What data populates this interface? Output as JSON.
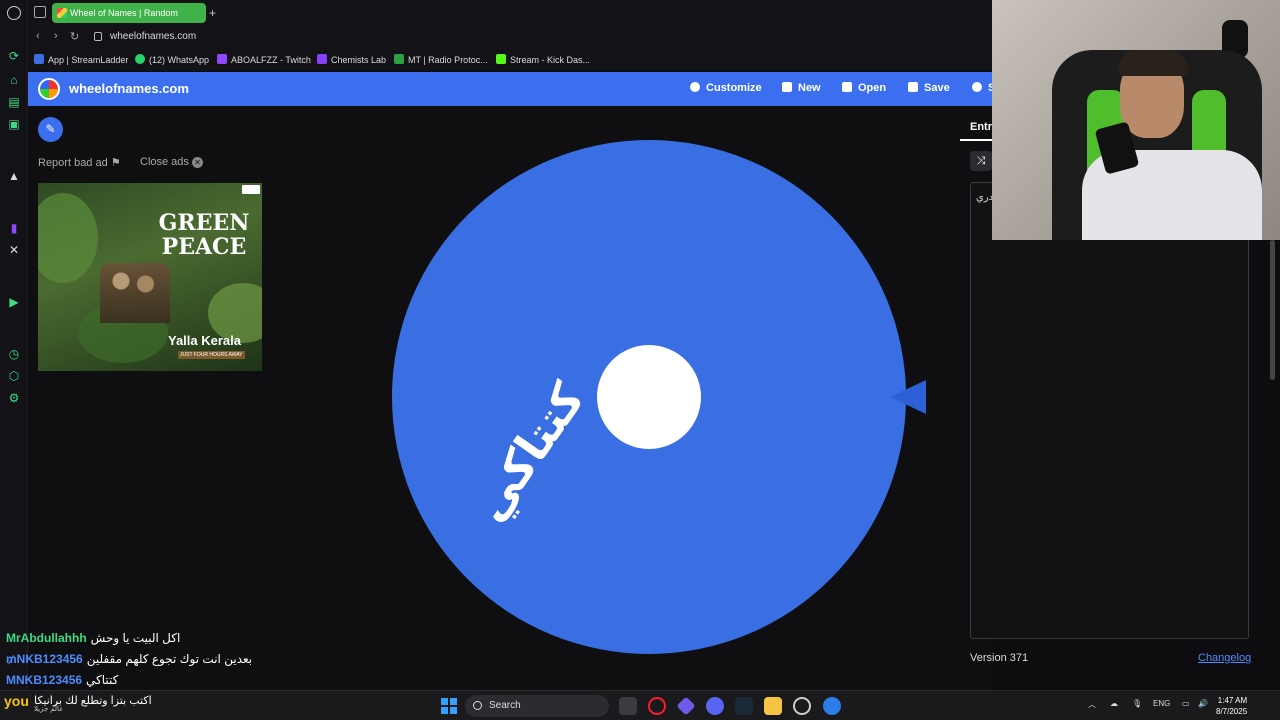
{
  "browser": {
    "tab_title": "Wheel of Names | Random",
    "url": "wheelofnames.com",
    "bookmarks": [
      {
        "label": "App | StreamLadder",
        "color": "#3a6ee3"
      },
      {
        "label": "(12) WhatsApp",
        "color": "#25d366"
      },
      {
        "label": "ABOALFZZ - Twitch",
        "color": "#9146ff"
      },
      {
        "label": "Chemists Lab",
        "color": "#8a3ffc"
      },
      {
        "label": "MT | Radio Protoc...",
        "color": "#2ea043"
      },
      {
        "label": "Stream - Kick Das...",
        "color": "#53fc18"
      }
    ]
  },
  "site": {
    "name": "wheelofnames.com",
    "buttons": {
      "customize": "Customize",
      "new": "New",
      "open": "Open",
      "save": "Save",
      "share": "S"
    },
    "report_ad": "Report bad ad",
    "close_ads": "Close ads",
    "ad": {
      "title": "GREEN PEACE",
      "brand": "Yalla Kerala",
      "subline": "JUST FOUR HOURS AWAY"
    },
    "wheel": {
      "color": "#3a6ee3",
      "segment_text": "كتتاكي"
    },
    "panel": {
      "tab": "Entri",
      "entry": "ـدري",
      "version": "Version 371",
      "changelog": "Changelog"
    }
  },
  "chat": [
    {
      "user": "MrAbdullahhh",
      "color": "#3ddc84",
      "message": "اكل البيت يا وحش"
    },
    {
      "user": "₥NKB123456",
      "color": "#4d8cff",
      "message": "بعدين انت توك تجوع كلهم مقفلين"
    },
    {
      "user": "MNKB123456",
      "color": "#4d8cff",
      "message": "كتتاكي"
    },
    {
      "user": "you",
      "color": "#f5c518",
      "message": "اكتب بتزا وتطلع لك برانيكا"
    }
  ],
  "stream_overlay": {
    "logo": "you",
    "sub": "عالم جزيلا"
  },
  "taskbar": {
    "search": "Search",
    "lang": "ENG",
    "time": "1:47 AM",
    "date": "8/7/2025"
  }
}
